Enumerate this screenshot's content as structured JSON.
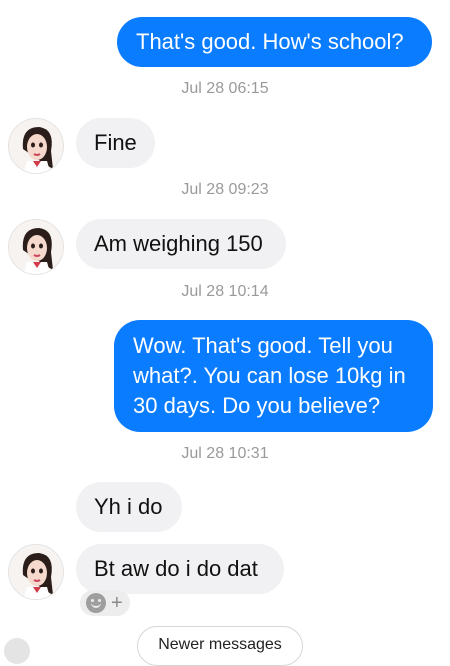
{
  "messages": [
    {
      "text": "That's good. How's school?"
    },
    {
      "text": "Fine"
    },
    {
      "text": "Am weighing 150"
    },
    {
      "text": "Wow. That's good. Tell you what?. You can lose 10kg in 30 days. Do you believe?"
    },
    {
      "text": "Yh i do"
    },
    {
      "text": "Bt aw do i do dat"
    }
  ],
  "timestamps": [
    "Jul 28 06:15",
    "Jul 28 09:23",
    "Jul 28 10:14",
    "Jul 28 10:31"
  ],
  "newer_button": "Newer messages",
  "colors": {
    "outgoing_bubble": "#0a7cff",
    "incoming_bubble": "#f1f1f3",
    "timestamp": "#9a9a9a"
  },
  "icons": {
    "reaction": "smiley-icon",
    "add_reaction": "plus-icon"
  }
}
